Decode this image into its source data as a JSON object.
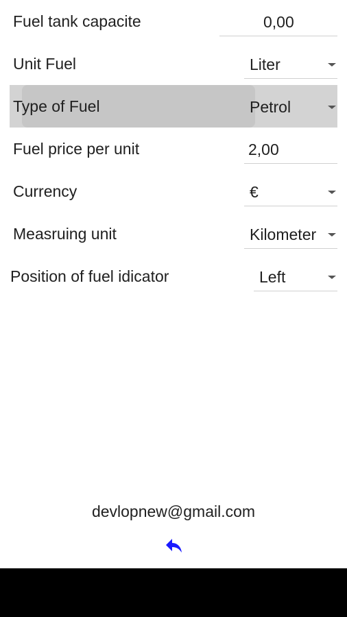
{
  "settings": [
    {
      "label": "Fuel tank capacite",
      "value": "0,00",
      "kind": "input"
    },
    {
      "label": "Unit Fuel",
      "value": "Liter",
      "kind": "dropdown"
    },
    {
      "label": "Type of Fuel",
      "value": "Petrol",
      "kind": "dropdown",
      "pressed": true
    },
    {
      "label": "Fuel price per unit",
      "value": "2,00",
      "kind": "input"
    },
    {
      "label": "Currency",
      "value": "€",
      "kind": "dropdown"
    },
    {
      "label": "Measruing unit",
      "value": "Kilometer",
      "kind": "dropdown"
    },
    {
      "label": "Position of fuel idicator",
      "value": "Left",
      "kind": "dropdown"
    }
  ],
  "footer": {
    "email": "devlopnew@gmail.com",
    "back_icon": "reply-arrow-icon"
  },
  "colors": {
    "back_icon": "#1a1aff",
    "pressed_row": "#d3d3d3",
    "navbar": "#000000"
  }
}
